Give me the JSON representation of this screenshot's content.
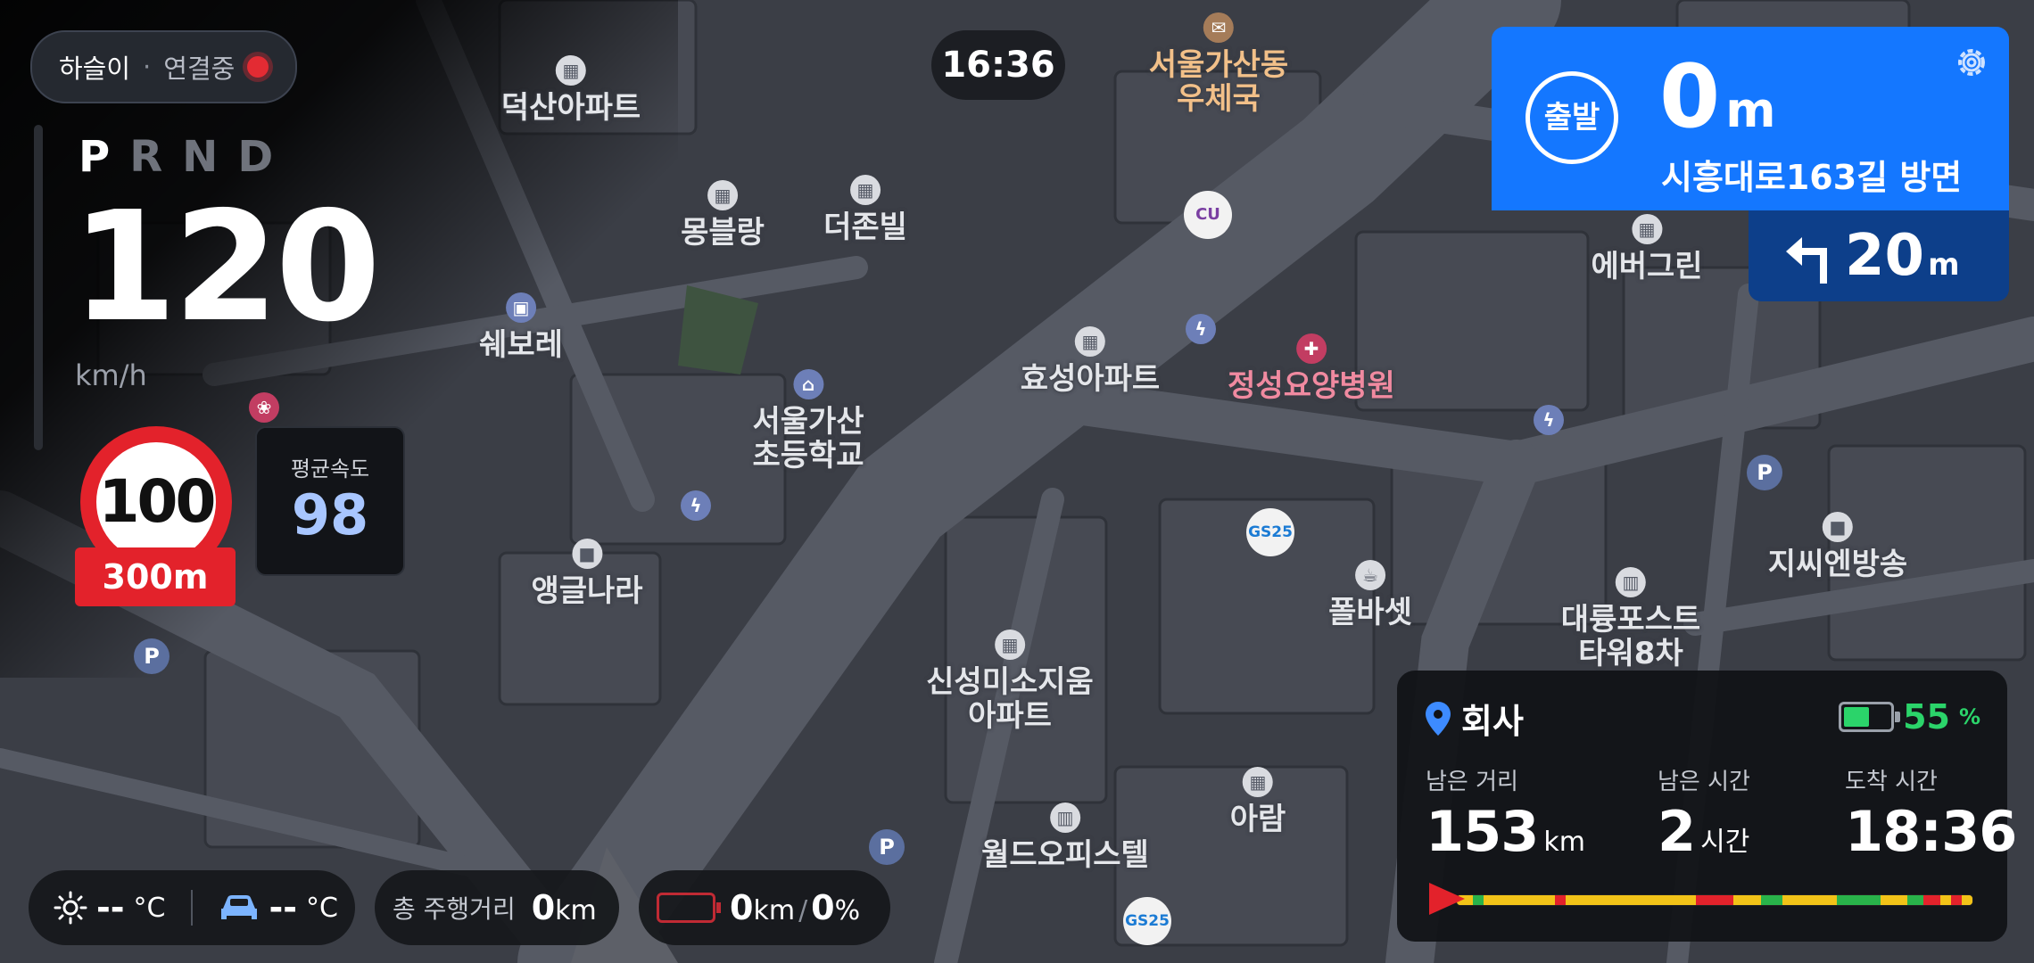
{
  "connection": {
    "name": "하슬이",
    "separator": "·",
    "status": "연결중"
  },
  "clock": "16:36",
  "gears": [
    "P",
    "R",
    "N",
    "D"
  ],
  "active_gear": "P",
  "speed": {
    "value": "120",
    "unit": "km/h"
  },
  "speed_limit": {
    "value": "100",
    "distance": "300m"
  },
  "average_speed": {
    "label": "평균속도",
    "value": "98"
  },
  "turn": {
    "badge": "출발",
    "distance": "0",
    "unit": "m",
    "road": "시흥대로163길 방면"
  },
  "next_turn": {
    "distance": "20",
    "unit": "m",
    "icon": "turn-left-arrow-icon"
  },
  "trip": {
    "destination": "회사",
    "battery_percent": "55",
    "battery_unit": "%",
    "battery_level": 0.55,
    "remaining_distance": {
      "label": "남은 거리",
      "value": "153",
      "unit": "km"
    },
    "remaining_time": {
      "label": "남은 시간",
      "value": "2",
      "unit": "시간"
    },
    "arrival_time": {
      "label": "도착 시간",
      "value": "18:36"
    }
  },
  "traffic_segments": [
    {
      "color": "#f2c318",
      "share": 3
    },
    {
      "color": "#29b34a",
      "share": 2
    },
    {
      "color": "#f2c318",
      "share": 13
    },
    {
      "color": "#e3222b",
      "share": 2
    },
    {
      "color": "#f2c318",
      "share": 24
    },
    {
      "color": "#e3222b",
      "share": 7
    },
    {
      "color": "#f2c318",
      "share": 5
    },
    {
      "color": "#29b34a",
      "share": 4
    },
    {
      "color": "#f2c318",
      "share": 10
    },
    {
      "color": "#29b34a",
      "share": 8
    },
    {
      "color": "#f2c318",
      "share": 5
    },
    {
      "color": "#29b34a",
      "share": 3
    },
    {
      "color": "#e3222b",
      "share": 3
    },
    {
      "color": "#f2c318",
      "share": 2
    },
    {
      "color": "#e3222b",
      "share": 2
    },
    {
      "color": "#f2c318",
      "share": 2
    }
  ],
  "bottom": {
    "outside_temp": "--",
    "inside_temp": "--",
    "temp_unit": "°C",
    "odometer_label": "총 주행거리",
    "odometer_value": "0",
    "odometer_unit": "km",
    "ev_range_value": "0",
    "ev_range_unit": "km",
    "ev_slash": "/",
    "ev_percent_value": "0",
    "ev_percent_unit": "%"
  },
  "map_labels": [
    {
      "text": "덕산아파트",
      "icon": "building-icon",
      "style": "",
      "pos": 0
    },
    {
      "text": "몽블랑",
      "icon": "building-icon",
      "style": "",
      "pos": 1
    },
    {
      "text": "더존빌",
      "icon": "building-icon",
      "style": "",
      "pos": 2
    },
    {
      "text": "서울가산동\n우체국",
      "icon": "post-office-icon",
      "style": "orange",
      "pos": 3
    },
    {
      "text": "쉐보레",
      "icon": "car-dealer-icon",
      "style": "blue",
      "pos": 4
    },
    {
      "text": "서울가산\n초등학교",
      "icon": "school-icon",
      "style": "blue",
      "pos": 5
    },
    {
      "text": "효성아파트",
      "icon": "building-icon",
      "style": "",
      "pos": 6
    },
    {
      "text": "정성요양병원",
      "icon": "hospital-icon",
      "style": "pink",
      "pos": 7
    },
    {
      "text": "앵글나라",
      "icon": "place-icon",
      "style": "",
      "pos": 8
    },
    {
      "text": "폴바셋",
      "icon": "cafe-icon",
      "style": "",
      "pos": 9
    },
    {
      "text": "에버그린",
      "icon": "building-icon",
      "style": "",
      "pos": 10
    },
    {
      "text": "지씨엔방송",
      "icon": "place-icon",
      "style": "",
      "pos": 11
    },
    {
      "text": "대륭포스트\n타워8차",
      "icon": "office-icon",
      "style": "",
      "pos": 12
    },
    {
      "text": "신성미소지움\n아파트",
      "icon": "building-icon",
      "style": "",
      "pos": 13
    },
    {
      "text": "월드오피스텔",
      "icon": "office-icon",
      "style": "",
      "pos": 14
    },
    {
      "text": "아람",
      "icon": "building-icon",
      "style": "",
      "pos": 15
    },
    {
      "text": "",
      "icon": "cu-store-icon",
      "brand": "CU",
      "style": "brandcu",
      "pos": 16
    },
    {
      "text": "",
      "icon": "gs25-store-icon",
      "brand": "GS25",
      "style": "brandgs",
      "pos": 17
    },
    {
      "text": "",
      "icon": "gs25-store-icon",
      "brand": "GS25",
      "style": "brandgs",
      "pos": 18
    },
    {
      "text": "",
      "icon": "ev-charger-icon",
      "style": "blue",
      "pos": 19
    },
    {
      "text": "",
      "icon": "ev-charger-icon",
      "style": "blue",
      "pos": 20
    },
    {
      "text": "",
      "icon": "ev-charger-icon",
      "style": "blue",
      "pos": 21
    },
    {
      "text": "",
      "icon": "pet-icon",
      "style": "pink",
      "pos": 22
    }
  ],
  "parking_marks": [
    "P",
    "P",
    "P"
  ]
}
